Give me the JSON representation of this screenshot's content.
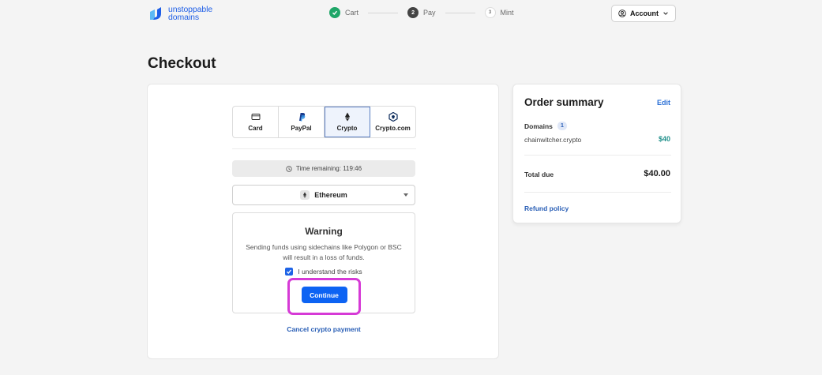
{
  "header": {
    "logo_line1": "unstoppable",
    "logo_line2": "domains",
    "steps": [
      {
        "number": "1",
        "label": "Cart",
        "state": "done"
      },
      {
        "number": "2",
        "label": "Pay",
        "state": "active"
      },
      {
        "number": "3",
        "label": "Mint",
        "state": "pending"
      }
    ],
    "account_label": "Account"
  },
  "page": {
    "title": "Checkout"
  },
  "payment": {
    "methods": [
      {
        "label": "Card",
        "icon": "credit-card-icon",
        "selected": false
      },
      {
        "label": "PayPal",
        "icon": "paypal-icon",
        "selected": false
      },
      {
        "label": "Crypto",
        "icon": "ethereum-icon",
        "selected": true
      },
      {
        "label": "Crypto.com",
        "icon": "cryptocom-icon",
        "selected": false
      }
    ],
    "timer_text": "Time remaining: 119:46",
    "network": "Ethereum",
    "warning": {
      "title": "Warning",
      "text": "Sending funds using sidechains like Polygon or BSC will result in a loss of funds.",
      "ack_label": "I understand the risks",
      "ack_checked": true,
      "continue_label": "Continue"
    },
    "cancel_label": "Cancel crypto payment"
  },
  "summary": {
    "title": "Order summary",
    "edit_label": "Edit",
    "domains_label": "Domains",
    "domains_count": "1",
    "domain_name": "chainwitcher.crypto",
    "domain_price": "$40",
    "total_label": "Total due",
    "total_value": "$40.00",
    "refund_label": "Refund policy"
  },
  "colors": {
    "brand_blue": "#1e5ee6",
    "primary_button": "#0d63f3",
    "highlight_outline": "#d63ad6",
    "step_done": "#1fa668",
    "price_teal": "#1f8f8a"
  }
}
